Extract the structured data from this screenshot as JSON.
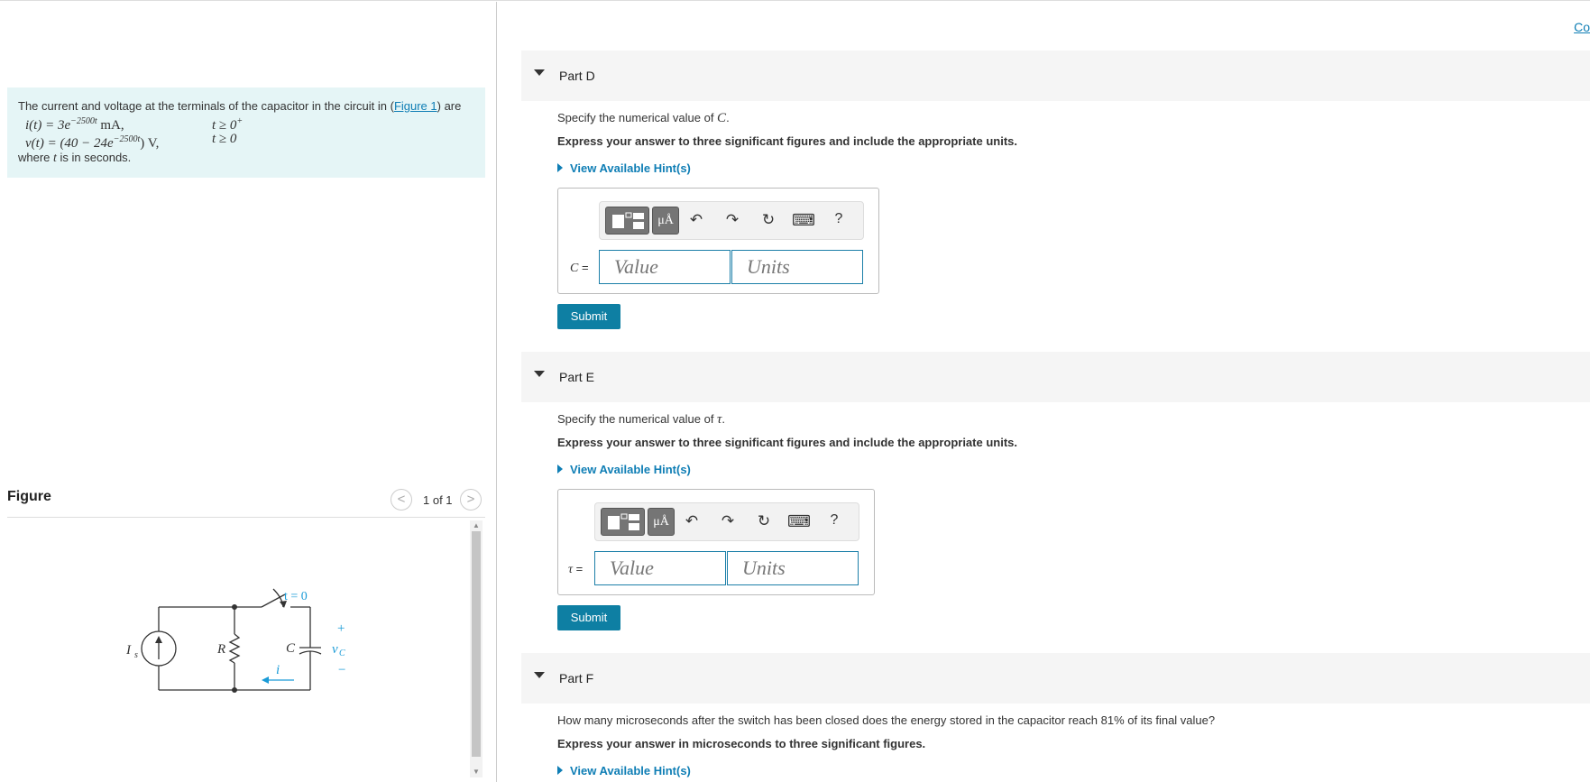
{
  "corner_link": "Co",
  "intro": {
    "text_before": "The current and voltage at the terminals of the capacitor in the circuit in (",
    "figure_link": "Figure 1",
    "text_after": ") are",
    "eq1_left": "i(t) = 3e",
    "eq1_exp": "−2500t",
    "eq1_unit": " mA,",
    "eq1_cond": "t ≥ 0",
    "eq1_cond_sup": "+",
    "eq2_left": "v(t) = (40 − 24e",
    "eq2_exp": "−2500t",
    "eq2_unit": ") V,",
    "eq2_cond": "t ≥ 0",
    "where_before": "where ",
    "where_var": "t",
    "where_after": " is in seconds."
  },
  "figure": {
    "title": "Figure",
    "prev": "<",
    "next": ">",
    "counter": "1 of 1",
    "labels": {
      "source": "I",
      "source_sub": "s",
      "resistor": "R",
      "capacitor": "C",
      "switch": "t = 0",
      "plus": "+",
      "minus": "−",
      "vc": "v",
      "vc_sub": "C",
      "current": "i"
    }
  },
  "parts": [
    {
      "label": "Part D",
      "q_before": "Specify the numerical value of ",
      "q_var": "C",
      "q_after": ".",
      "instruction": "Express your answer to three significant figures and include the appropriate units.",
      "hint": "View Available Hint(s)",
      "input_label": "C",
      "value_placeholder": "Value",
      "units_placeholder": "Units",
      "submit": "Submit"
    },
    {
      "label": "Part E",
      "q_before": "Specify the numerical value of ",
      "q_var": "τ",
      "q_after": ".",
      "instruction": "Express your answer to three significant figures and include the appropriate units.",
      "hint": "View Available Hint(s)",
      "input_label": "τ",
      "value_placeholder": "Value",
      "units_placeholder": "Units",
      "submit": "Submit"
    },
    {
      "label": "Part F",
      "q_before": "How many microseconds after the switch has been closed does the energy stored in the capacitor reach 81% of its final value?",
      "instruction": "Express your answer in microseconds to three significant figures.",
      "hint": "View Available Hint(s)"
    }
  ],
  "toolbar": {
    "units_btn": "μÅ",
    "undo": "↶",
    "redo": "↷",
    "reset": "↻",
    "keyboard": "⌨",
    "help": "?",
    "equals": " ="
  },
  "colors": {
    "accent": "#0f7eb5",
    "submit": "#0e7fa3",
    "intro_bg": "#e5f5f6",
    "circuit_blue": "#1a9bd7"
  }
}
